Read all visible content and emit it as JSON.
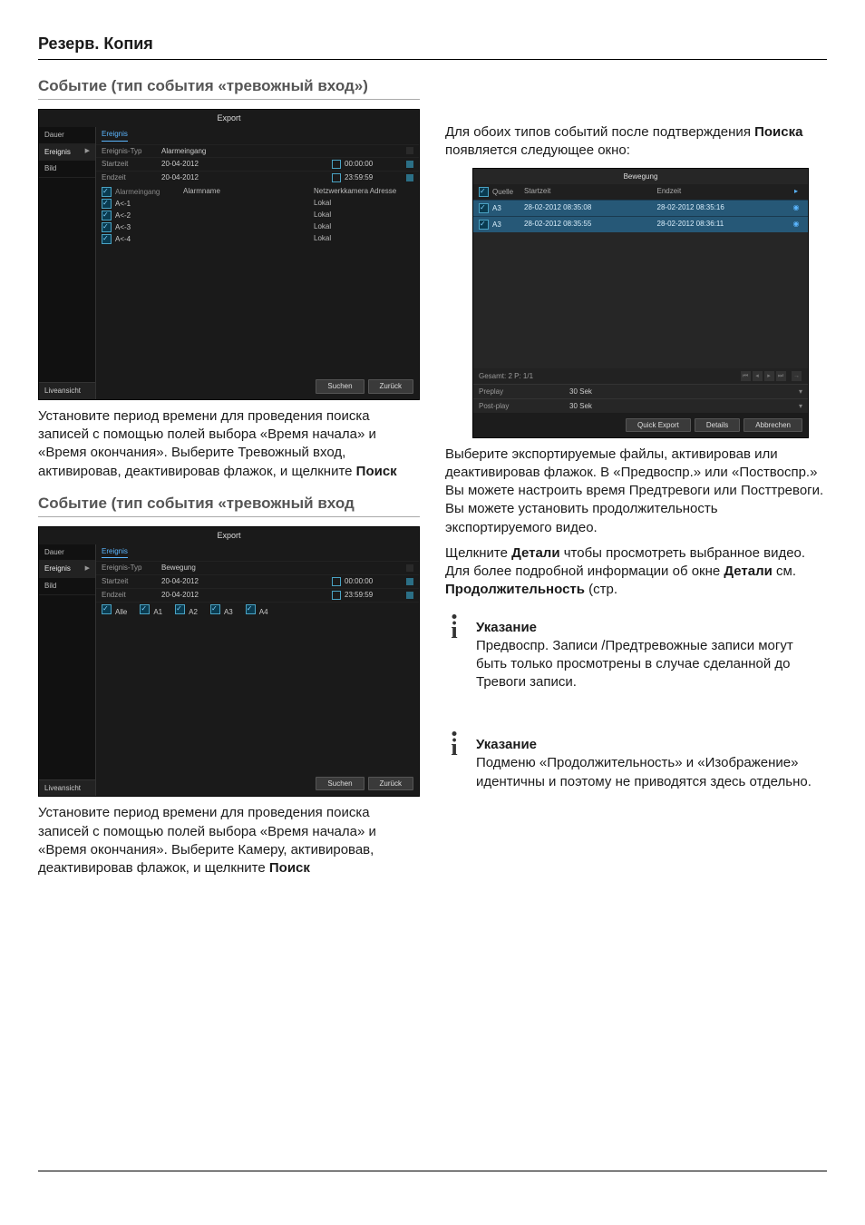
{
  "pageTitle": "Резерв. Копия",
  "section1": {
    "heading": "Событие (тип события «тревожный вход»)",
    "para1_a": "Установите период времени для проведения поиска записей с помощью полей выбора «Время начала» и «Время окончания». Выберите Тревожный вход, активировав, деактивировав флажок, и щелкните ",
    "para1_b": "Поиск"
  },
  "section2": {
    "heading": "Событие (тип события «тревожный вход",
    "para1_a": "Установите период времени для проведения поиска записей с помощью полей выбора «Время начала» и «Время окончания». Выберите Камеру, активировав, деактивировав флажок, и щелкните ",
    "para1_b": "Поиск"
  },
  "right": {
    "intro_a": "Для обоих типов событий после подтверждения ",
    "intro_b": "Поиска",
    "intro_c": " появляется следующее окно:",
    "after1": "Выберите экспортируемые файлы, активировав или деактивировав флажок. В «Предвоспр.» или «Поствоспр.» Вы можете настроить время Предтревоги или Посттревоги. Вы можете установить продолжительность экспортируемого видео.",
    "after2_a": "Щелкните ",
    "after2_b": "Детали",
    "after2_c": " чтобы просмотреть выбранное видео. Для более подробной информации об окне ",
    "after2_d": "Детали",
    "after2_e": " см. ",
    "after2_f": "Продолжительность",
    "after2_g": " (стр."
  },
  "note1": {
    "title": "Указание",
    "body": "Предвоспр. Записи /Предтревожные записи могут быть только просмотрены в случае сделанной до Тревоги записи."
  },
  "note2": {
    "title": "Указание",
    "body": "Подменю «Продолжительность» и «Изображение» идентичны и поэтому не приводятся здесь отдельно."
  },
  "panelA": {
    "title": "Export",
    "sidebar": {
      "dauer": "Dauer",
      "ereignis": "Ereignis",
      "bild": "Bild",
      "live": "Liveansicht"
    },
    "subtab": "Ereignis",
    "rows": {
      "type": {
        "lbl": "Ereignis-Typ",
        "val": "Alarmeingang"
      },
      "start": {
        "lbl": "Startzeit",
        "date": "20-04-2012",
        "time": "00:00:00"
      },
      "end": {
        "lbl": "Endzeit",
        "date": "20-04-2012",
        "time": "23:59:59"
      }
    },
    "listHeader": {
      "c1": "Alarmeingang",
      "c2": "Alarmname",
      "c3": "Netzwerkkamera Adresse"
    },
    "list": [
      {
        "name": "A<-1",
        "loc": "Lokal"
      },
      {
        "name": "A<-2",
        "loc": "Lokal"
      },
      {
        "name": "A<-3",
        "loc": "Lokal"
      },
      {
        "name": "A<-4",
        "loc": "Lokal"
      }
    ],
    "buttons": {
      "search": "Suchen",
      "back": "Zurück"
    }
  },
  "panelB": {
    "title": "Export",
    "sidebar": {
      "dauer": "Dauer",
      "ereignis": "Ereignis",
      "bild": "Bild",
      "live": "Liveansicht"
    },
    "subtab": "Ereignis",
    "rows": {
      "type": {
        "lbl": "Ereignis-Typ",
        "val": "Bewegung"
      },
      "start": {
        "lbl": "Startzeit",
        "date": "20-04-2012",
        "time": "00:00:00"
      },
      "end": {
        "lbl": "Endzeit",
        "date": "20-04-2012",
        "time": "23:59:59"
      }
    },
    "chkAll": "Alle",
    "chks": [
      "A1",
      "A2",
      "A3",
      "A4"
    ],
    "buttons": {
      "search": "Suchen",
      "back": "Zurück"
    }
  },
  "panelR": {
    "title": "Bewegung",
    "head": {
      "c1": "Quelle",
      "c2": "Startzeit",
      "c3": "Endzeit"
    },
    "rows": [
      {
        "src": "A3",
        "start": "28-02-2012 08:35:08",
        "end": "28-02-2012 08:35:16"
      },
      {
        "src": "A3",
        "start": "28-02-2012 08:35:55",
        "end": "28-02-2012 08:36:11"
      }
    ],
    "total": "Gesamt: 2 P: 1/1",
    "preplay": {
      "lbl": "Preplay",
      "val": "30 Sek"
    },
    "postplay": {
      "lbl": "Post-play",
      "val": "30 Sek"
    },
    "buttons": {
      "quick": "Quick Export",
      "details": "Details",
      "cancel": "Abbrechen"
    }
  }
}
